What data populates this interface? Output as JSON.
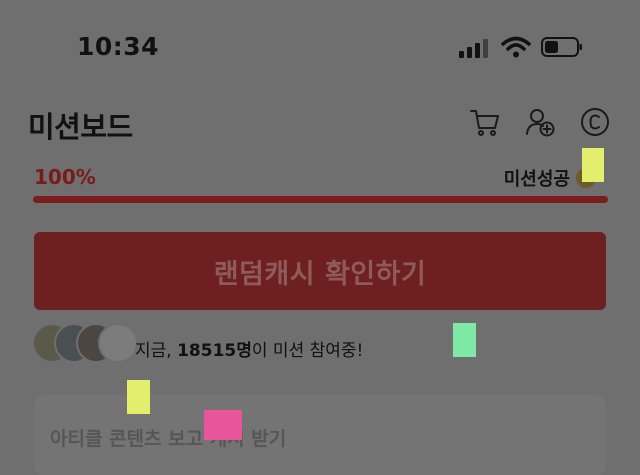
{
  "status_bar": {
    "time": "10:34",
    "icons": [
      "signal-icon",
      "wifi-icon",
      "battery-icon"
    ]
  },
  "header": {
    "title": "미션보드",
    "icons": [
      "cart-icon",
      "add-friend-icon",
      "cash-icon"
    ]
  },
  "progress": {
    "percent_label": "100%",
    "value": 1.0,
    "status_label": "미션성공"
  },
  "cta": {
    "label": "랜덤캐시 확인하기"
  },
  "participants": {
    "prefix": "지금, ",
    "count_label": "18515명",
    "suffix": "이 미션 참여중!"
  },
  "card": {
    "text": "아티클 콘텐츠 보고 캐시 받기"
  },
  "colors": {
    "accent": "#7b1d1d",
    "cta_bg": "#6e1f1f",
    "overlay_bg": "#6f6f6f",
    "marker_yellow": "#e4ee6d",
    "marker_green": "#7ee8a5",
    "marker_pink": "#e8559a"
  }
}
